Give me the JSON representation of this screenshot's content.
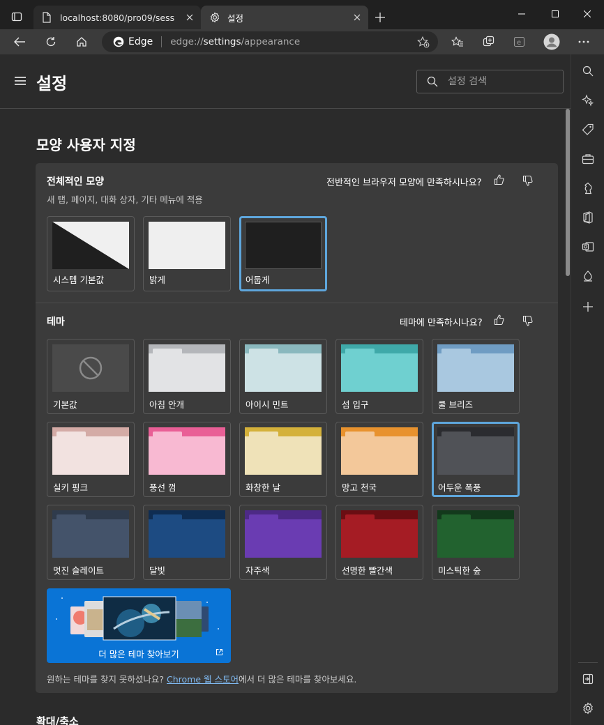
{
  "tabs": [
    {
      "title": "localhost:8080/pro09/sess",
      "icon": "page-icon"
    },
    {
      "title": "설정",
      "icon": "gear-icon"
    }
  ],
  "address": {
    "brand": "Edge",
    "url_prefix": "edge://",
    "url_bold": "settings",
    "url_suffix": "/appearance"
  },
  "header": {
    "title": "설정",
    "search_placeholder": "설정 검색"
  },
  "section_title": "모양 사용자 지정",
  "overall": {
    "heading": "전체적인 모양",
    "subtitle": "새 탭, 페이지, 대화 상자, 기타 메뉴에 적용",
    "feedback": "전반적인 브라우저 모양에 만족하시나요?",
    "options": [
      {
        "label": "시스템 기본값",
        "selected": false
      },
      {
        "label": "밝게",
        "selected": false
      },
      {
        "label": "어둡게",
        "selected": true
      }
    ]
  },
  "theme": {
    "heading": "테마",
    "feedback": "테마에 만족하시나요?",
    "items": [
      {
        "label": "기본값",
        "top": "#4a4a4a",
        "body": "#4a4a4a",
        "tab": "#4a4a4a",
        "selected": false,
        "default": true
      },
      {
        "label": "아침 안개",
        "top": "#b4b6ba",
        "body": "#e2e3e5",
        "tab": "#e2e3e5",
        "selected": false
      },
      {
        "label": "아이시 민트",
        "top": "#8ab8be",
        "body": "#cde2e5",
        "tab": "#cde2e5",
        "selected": false
      },
      {
        "label": "섬 입구",
        "top": "#3fa9a9",
        "body": "#6fd0d0",
        "tab": "#6fd0d0",
        "selected": false
      },
      {
        "label": "쿨 브리즈",
        "top": "#6f9cc3",
        "body": "#a9c8e0",
        "tab": "#a9c8e0",
        "selected": false
      },
      {
        "label": "실키 핑크",
        "top": "#d4aba6",
        "body": "#f2e2e0",
        "tab": "#f2e2e0",
        "selected": false
      },
      {
        "label": "풍선 껌",
        "top": "#e95f96",
        "body": "#f8b9d2",
        "tab": "#f8b9d2",
        "selected": false
      },
      {
        "label": "화창한 날",
        "top": "#d4b13a",
        "body": "#efe2b8",
        "tab": "#efe2b8",
        "selected": false
      },
      {
        "label": "망고 천국",
        "top": "#e8922e",
        "body": "#f3c89a",
        "tab": "#f3c89a",
        "selected": false
      },
      {
        "label": "어두운 폭풍",
        "top": "#2b2c30",
        "body": "#505257",
        "tab": "#505257",
        "selected": true
      },
      {
        "label": "멋진 슬레이트",
        "top": "#2f3b4c",
        "body": "#44536a",
        "tab": "#44536a",
        "selected": false
      },
      {
        "label": "달빛",
        "top": "#0f2d52",
        "body": "#1d4b82",
        "tab": "#1d4b82",
        "selected": false
      },
      {
        "label": "자주색",
        "top": "#4d2a86",
        "body": "#6a3cb2",
        "tab": "#6a3cb2",
        "selected": false
      },
      {
        "label": "선명한 빨간색",
        "top": "#6a0e13",
        "body": "#a51c24",
        "tab": "#a51c24",
        "selected": false
      },
      {
        "label": "미스틱한 숲",
        "top": "#13391c",
        "body": "#22622f",
        "tab": "#22622f",
        "selected": false
      }
    ],
    "more_label": "더 많은 테마 찾아보기",
    "footnote_before": "원하는 테마를 찾지 못하셨나요? ",
    "footnote_link": "Chrome 웹 스토어",
    "footnote_after": "에서 더 많은 테마를 찾아보세요."
  },
  "zoom_title": "확대/축소",
  "colors": {
    "accent": "#5ea6dc",
    "store_blue": "#0a74d6"
  }
}
